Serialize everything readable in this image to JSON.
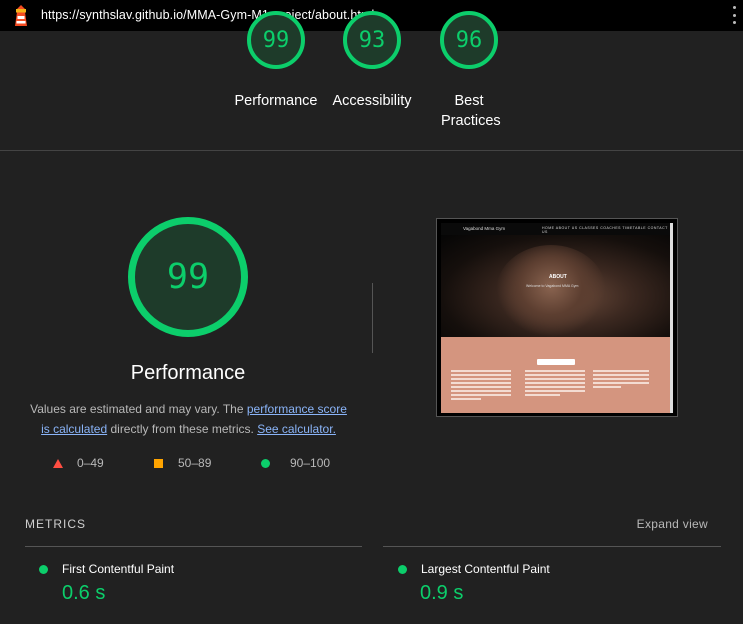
{
  "browser": {
    "url": "https://synthslav.github.io/MMA-Gym-M1-project/about.html",
    "logo_icon": "lighthouse-icon",
    "menu_icon": "kebab-menu-icon"
  },
  "summary_gauges": [
    {
      "score": "99",
      "label": "Performance"
    },
    {
      "score": "93",
      "label": "Accessibility"
    },
    {
      "score": "96",
      "label": "Best Practices"
    }
  ],
  "performance": {
    "score": "99",
    "title": "Performance",
    "desc_prefix": "Values are estimated and may vary. The ",
    "link_score": "performance score is calculated",
    "desc_middle": " directly from these metrics. ",
    "link_calc": "See calculator."
  },
  "legend": [
    {
      "range": "0–49",
      "shape": "triangle",
      "color": "#ff4e42"
    },
    {
      "range": "50–89",
      "shape": "square",
      "color": "#ffa400"
    },
    {
      "range": "90–100",
      "shape": "circle",
      "color": "#0cce6b"
    }
  ],
  "screenshot": {
    "brand": "Vagabond Mma Gym",
    "nav": "HOME   ABOUT US   CLASSES   COACHES   TIMETABLE   CONTACT US",
    "hero_title": "ABOUT",
    "hero_sub": "Welcome to Vagabond MMA Gym"
  },
  "metrics": {
    "heading": "METRICS",
    "expand_label": "Expand view",
    "items": [
      {
        "name": "First Contentful Paint",
        "value": "0.6 s"
      },
      {
        "name": "Largest Contentful Paint",
        "value": "0.9 s"
      }
    ]
  },
  "colors": {
    "pass": "#0cce6b",
    "average": "#ffa400",
    "fail": "#ff4e42",
    "link": "#8ab4f8",
    "background": "#212121"
  }
}
